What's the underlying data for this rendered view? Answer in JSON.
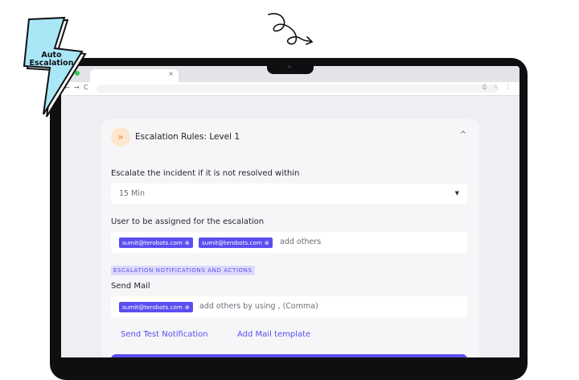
{
  "badge": {
    "line1": "Auto",
    "line2": "Escalation"
  },
  "browser": {
    "tab_close": "×",
    "nav": [
      "←",
      "→",
      "C"
    ],
    "url_icons": "⎙ ☆ ⋮"
  },
  "panel": {
    "header": {
      "icon": "double-chevron-up-icon",
      "title": "Escalation Rules: Level 1",
      "chevron": "^"
    },
    "escalate_label": "Escalate the incident if it is not resolved within",
    "duration": {
      "value": "15 Min",
      "arrow": "▼"
    },
    "assign_label": "User to be assigned for the escalation",
    "assign_chips": [
      "sumit@terobots.com",
      "sumit@terobots.com"
    ],
    "assign_placeholder": "add others",
    "section_tag": "ESCALATION NOTIFICATIONS AND ACTIONS",
    "send_mail_label": "Send Mail",
    "mail_chips": [
      "sumit@terobots.com"
    ],
    "mail_placeholder": "add others by using , (Comma)",
    "links": {
      "send_test": "Send Test Notification",
      "add_template": "Add Mail template"
    }
  },
  "colors": {
    "accent": "#5b4ef0",
    "badge_fill": "#a9e7f7",
    "chip_bg": "#5b4ef0"
  }
}
